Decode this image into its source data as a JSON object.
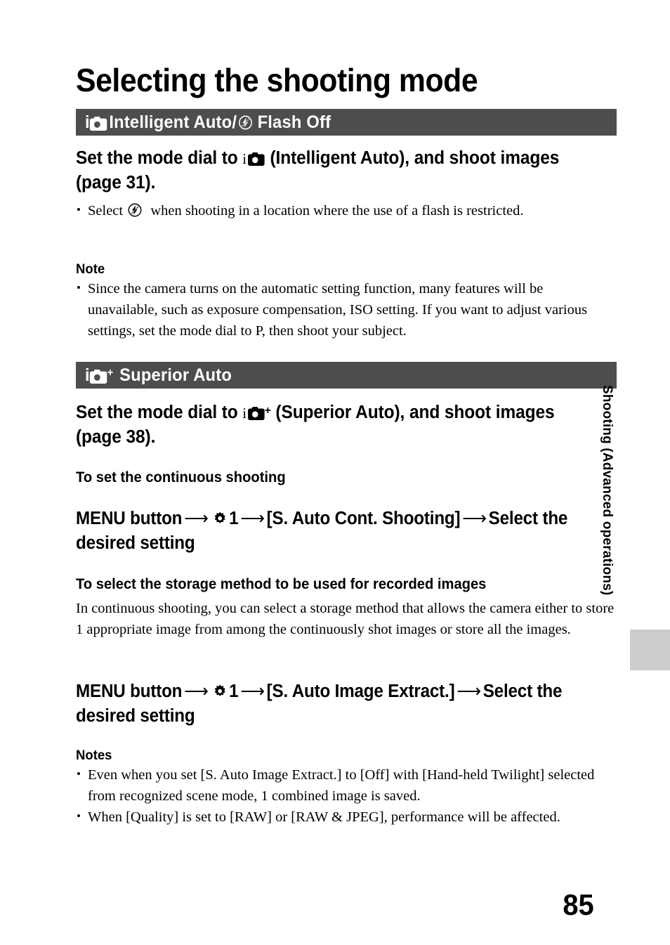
{
  "document": {
    "title": "Selecting the shooting mode",
    "page_number": "85",
    "side_tab_label": "Shooting (Advanced operations)",
    "tab_block_color": "#cccccc",
    "header_bar_color": "#4d4d4d"
  },
  "sections": [
    {
      "id": "intelligent-auto",
      "bar_prefix_i": "i",
      "bar_icon_camera": "camera-icon",
      "bar_text_1": "Intelligent Auto/",
      "bar_icon_flash_off": "flash-off-icon",
      "bar_text_2": "Flash Off",
      "lead_part_1": "Set the mode dial to ",
      "lead_prefix_i": "i",
      "lead_icon": "camera-icon",
      "lead_part_2": " (Intelligent Auto), and shoot images (page 31).",
      "bullet_part_1": "Select ",
      "bullet_icon": "flash-off-icon",
      "bullet_part_2": " when shooting in a location where the use of a flash is restricted.",
      "note_label": "Note",
      "notes": [
        "Since the camera turns on the automatic setting function, many features will be unavailable, such as exposure compensation, ISO setting. If you want to adjust various settings, set the mode dial to P, then shoot your subject."
      ]
    },
    {
      "id": "superior-auto",
      "bar_prefix_i": "i",
      "bar_icon_camera": "camera-icon",
      "bar_icon_plus": "+",
      "bar_text_1": "Superior Auto",
      "lead_part_1": "Set the mode dial to ",
      "lead_prefix_i": "i",
      "lead_icon": "camera-plus-icon",
      "lead_part_2": " (Superior Auto), and shoot images (page 38).",
      "subhead_continuous": "To set the continuous shooting",
      "menu_path_1": {
        "start": "MENU button",
        "arrow": "⟶",
        "icon": "gear-icon",
        "tab_number": "1",
        "item": "[S. Auto Cont. Shooting]",
        "end": "Select the desired setting"
      },
      "subhead_storage": "To select the storage method to be used for recorded images",
      "storage_body": "In continuous shooting, you can select a storage method that allows the camera either to store 1 appropriate image from among the continuously shot images or store all the images.",
      "menu_path_2": {
        "start": "MENU button",
        "arrow": "⟶",
        "icon": "gear-icon",
        "tab_number": "1",
        "item": "[S. Auto Image Extract.]",
        "end": "Select the desired setting"
      },
      "note_label": "Notes",
      "notes": [
        "Even when you set [S. Auto Image Extract.] to [Off] with [Hand-held Twilight] selected from recognized scene mode, 1 combined image is saved.",
        "When [Quality] is set to [RAW] or [RAW & JPEG], performance will be affected."
      ]
    }
  ]
}
